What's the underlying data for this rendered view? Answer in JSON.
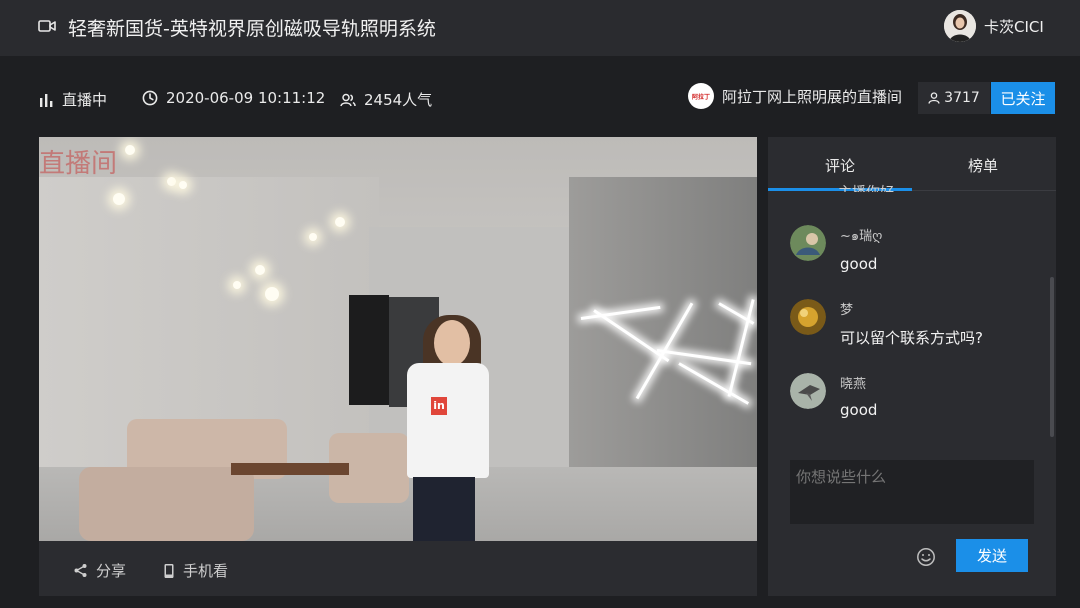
{
  "topbar": {
    "title": "轻奢新国货-英特视界原创磁吸导轨照明系统",
    "user_name": "卡茨CICI",
    "camera_icon": "video-camera-icon"
  },
  "info": {
    "status": "直播中",
    "datetime": "2020-06-09 10:11:12",
    "popularity": "2454人气"
  },
  "room": {
    "logo_text": "阿拉丁",
    "name": "阿拉丁网上照明展的直播间",
    "fans": "3717",
    "follow_label": "已关注"
  },
  "video": {
    "watermark": "直播间",
    "shirt_logo": "in"
  },
  "video_actions": {
    "share_label": "分享",
    "mobile_label": "手机看"
  },
  "panel": {
    "tabs": [
      {
        "label": "评论",
        "active": true
      },
      {
        "label": "榜单",
        "active": false
      }
    ],
    "clipped_text": "主播你好",
    "comments": [
      {
        "name": "~๑瑞ღ",
        "text": "good"
      },
      {
        "name": "梦",
        "text": "可以留个联系方式吗?"
      },
      {
        "name": "晓燕",
        "text": "good"
      }
    ],
    "input_placeholder": "你想说些什么",
    "send_label": "发送"
  },
  "colors": {
    "accent": "#1b8fe8",
    "background": "#1e1f22",
    "panel": "#2b2c30"
  }
}
